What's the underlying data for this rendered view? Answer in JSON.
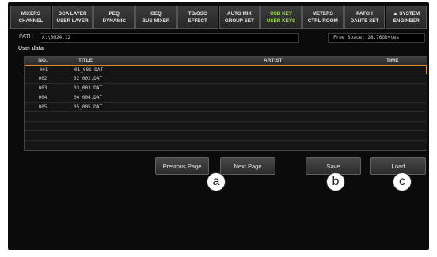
{
  "tabs": [
    {
      "line1": "MIXERS",
      "line2": "CHANNEL",
      "active": false
    },
    {
      "line1": "DCA LAYER",
      "line2": "USER LAYER",
      "active": false
    },
    {
      "line1": "PEQ",
      "line2": "DYNAMIC",
      "active": false
    },
    {
      "line1": "GEQ",
      "line2": "BUS MIXER",
      "active": false
    },
    {
      "line1": "TB/OSC",
      "line2": "EFFECT",
      "active": false
    },
    {
      "line1": "AUTO MIX",
      "line2": "GROUP SET",
      "active": false
    },
    {
      "line1": "USB KEY",
      "line2": "USER KEYS",
      "active": true
    },
    {
      "line1": "METERS",
      "line2": "CTRL ROOM",
      "active": false
    },
    {
      "line1": "PATCH",
      "line2": "DANTE SET",
      "active": false
    },
    {
      "line1": "▲ SYSTEM",
      "line2": "ENGINEER",
      "active": false
    }
  ],
  "path": {
    "label": "PATH",
    "value": "A:\\0M24.12"
  },
  "free_space": "Free Space:  28.76Gbytes",
  "user_data_label": "User data",
  "table": {
    "headers": {
      "no": "NO.",
      "title": "TITLE",
      "artist": "ARTIST",
      "time": "TIME"
    },
    "rows": [
      {
        "no": "001",
        "title": "01_001.DAT",
        "selected": true
      },
      {
        "no": "002",
        "title": "02_002.DAT",
        "selected": false
      },
      {
        "no": "003",
        "title": "03_003.DAT",
        "selected": false
      },
      {
        "no": "004",
        "title": "04_004.DAT",
        "selected": false
      },
      {
        "no": "005",
        "title": "05_005.DAT",
        "selected": false
      },
      {
        "no": "",
        "title": "",
        "selected": false
      },
      {
        "no": "",
        "title": "",
        "selected": false
      },
      {
        "no": "",
        "title": "",
        "selected": false
      }
    ]
  },
  "buttons": {
    "previous_page": "Previous Page",
    "next_page": "Next Page",
    "save": "Save",
    "load": "Load"
  },
  "markers": {
    "a": "a",
    "b": "b",
    "c": "c"
  },
  "colors": {
    "active_tab": "#9be24a",
    "selection_border": "#e08a2a",
    "background": "#0b0b0b"
  }
}
